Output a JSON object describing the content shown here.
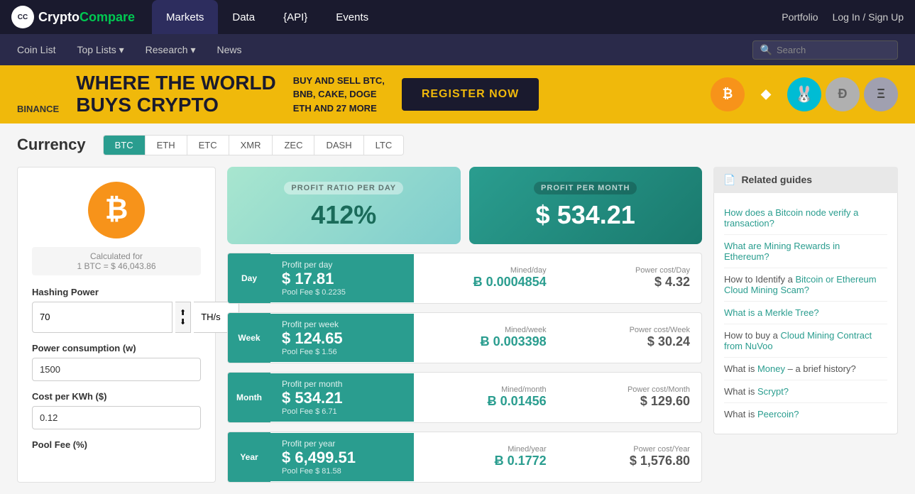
{
  "brand": {
    "name_part1": "Crypto",
    "name_part2": "Compare",
    "logo_symbol": "₿"
  },
  "top_nav": {
    "tabs": [
      {
        "label": "Markets",
        "active": true
      },
      {
        "label": "Data",
        "active": false
      },
      {
        "label": "{API}",
        "active": false
      },
      {
        "label": "Events",
        "active": false
      }
    ],
    "right_links": [
      {
        "label": "Portfolio"
      },
      {
        "label": "Log In / Sign Up"
      }
    ]
  },
  "sub_nav": {
    "items": [
      {
        "label": "Coin List"
      },
      {
        "label": "Top Lists ▾"
      },
      {
        "label": "Research ▾"
      },
      {
        "label": "News"
      }
    ],
    "search_placeholder": "Search"
  },
  "banner": {
    "brand": "BINANCE",
    "headline_line1": "WHERE THE WORLD",
    "headline_line2": "BUYS CRYPTO",
    "subtext": "BUY AND SELL BTC,\nBNB, CAKE, DOGE\nETH AND 27 MORE",
    "cta": "REGISTER NOW",
    "coins": [
      {
        "symbol": "₿",
        "bg": "#f7931a",
        "color": "white"
      },
      {
        "symbol": "◆",
        "bg": "#f0b90b",
        "color": "white"
      },
      {
        "symbol": "🐰",
        "bg": "#00bcd4",
        "color": "white"
      },
      {
        "symbol": "⬡",
        "bg": "#c0c0c0",
        "color": "#999"
      },
      {
        "symbol": "Ξ",
        "bg": "#c0c0c0",
        "color": "#555"
      }
    ]
  },
  "currency": {
    "title": "Currency",
    "tabs": [
      {
        "label": "BTC",
        "active": true
      },
      {
        "label": "ETH",
        "active": false
      },
      {
        "label": "ETC",
        "active": false
      },
      {
        "label": "XMR",
        "active": false
      },
      {
        "label": "ZEC",
        "active": false
      },
      {
        "label": "DASH",
        "active": false
      },
      {
        "label": "LTC",
        "active": false
      }
    ]
  },
  "calculator": {
    "btc_logo": "₿",
    "calc_for_label": "Calculated for",
    "calc_for_value": "1 BTC = $ 46,043.86",
    "hashing_power_label": "Hashing Power",
    "hashing_power_value": "70",
    "hashing_power_unit": "TH/s",
    "power_consumption_label": "Power consumption (w)",
    "power_consumption_value": "1500",
    "cost_per_kwh_label": "Cost per KWh ($)",
    "cost_per_kwh_value": "0.12",
    "pool_fee_label": "Pool Fee (%)"
  },
  "profit_summary": {
    "day_label": "PROFIT RATIO PER DAY",
    "day_value": "412%",
    "month_label": "PROFIT PER MONTH",
    "month_value": "$ 534.21"
  },
  "stats": [
    {
      "period": "Day",
      "profit_label": "Profit per day",
      "profit_value": "$ 17.81",
      "pool_fee": "Pool Fee $ 0.2235",
      "mined_label": "Mined/day",
      "mined_value": "Ƀ 0.0004854",
      "cost_label": "Power cost/Day",
      "cost_value": "$ 4.32"
    },
    {
      "period": "Week",
      "profit_label": "Profit per week",
      "profit_value": "$ 124.65",
      "pool_fee": "Pool Fee $ 1.56",
      "mined_label": "Mined/week",
      "mined_value": "Ƀ 0.003398",
      "cost_label": "Power cost/Week",
      "cost_value": "$ 30.24"
    },
    {
      "period": "Month",
      "profit_label": "Profit per month",
      "profit_value": "$ 534.21",
      "pool_fee": "Pool Fee $ 6.71",
      "mined_label": "Mined/month",
      "mined_value": "Ƀ 0.01456",
      "cost_label": "Power cost/Month",
      "cost_value": "$ 129.60"
    },
    {
      "period": "Year",
      "profit_label": "Profit per year",
      "profit_value": "$ 6,499.51",
      "pool_fee": "Pool Fee $ 81.58",
      "mined_label": "Mined/year",
      "mined_value": "Ƀ 0.1772",
      "cost_label": "Power cost/Year",
      "cost_value": "$ 1,576.80"
    }
  ],
  "guides": {
    "title": "Related guides",
    "items": [
      {
        "link_text": "How does a Bitcoin node verify a transaction?",
        "is_link": true
      },
      {
        "link_text": "What are Mining Rewards in Ethereum?",
        "is_link": true
      },
      {
        "prefix": "How to Identify a ",
        "link_text": "Bitcoin or Ethereum Cloud Mining Scam?",
        "is_link": true
      },
      {
        "link_text": "What is a Merkle Tree?",
        "is_link": true
      },
      {
        "prefix": "How to buy a ",
        "link_text": "Cloud Mining Contract from NuVoo",
        "is_link": true
      },
      {
        "prefix": "What is ",
        "link_text": "Money",
        "suffix": " – a brief history?",
        "is_link": true
      },
      {
        "prefix": "What is ",
        "link_text": "Scrypt?",
        "is_link": true
      },
      {
        "prefix": "What is ",
        "link_text": "Peercoin?",
        "is_link": true
      }
    ]
  }
}
